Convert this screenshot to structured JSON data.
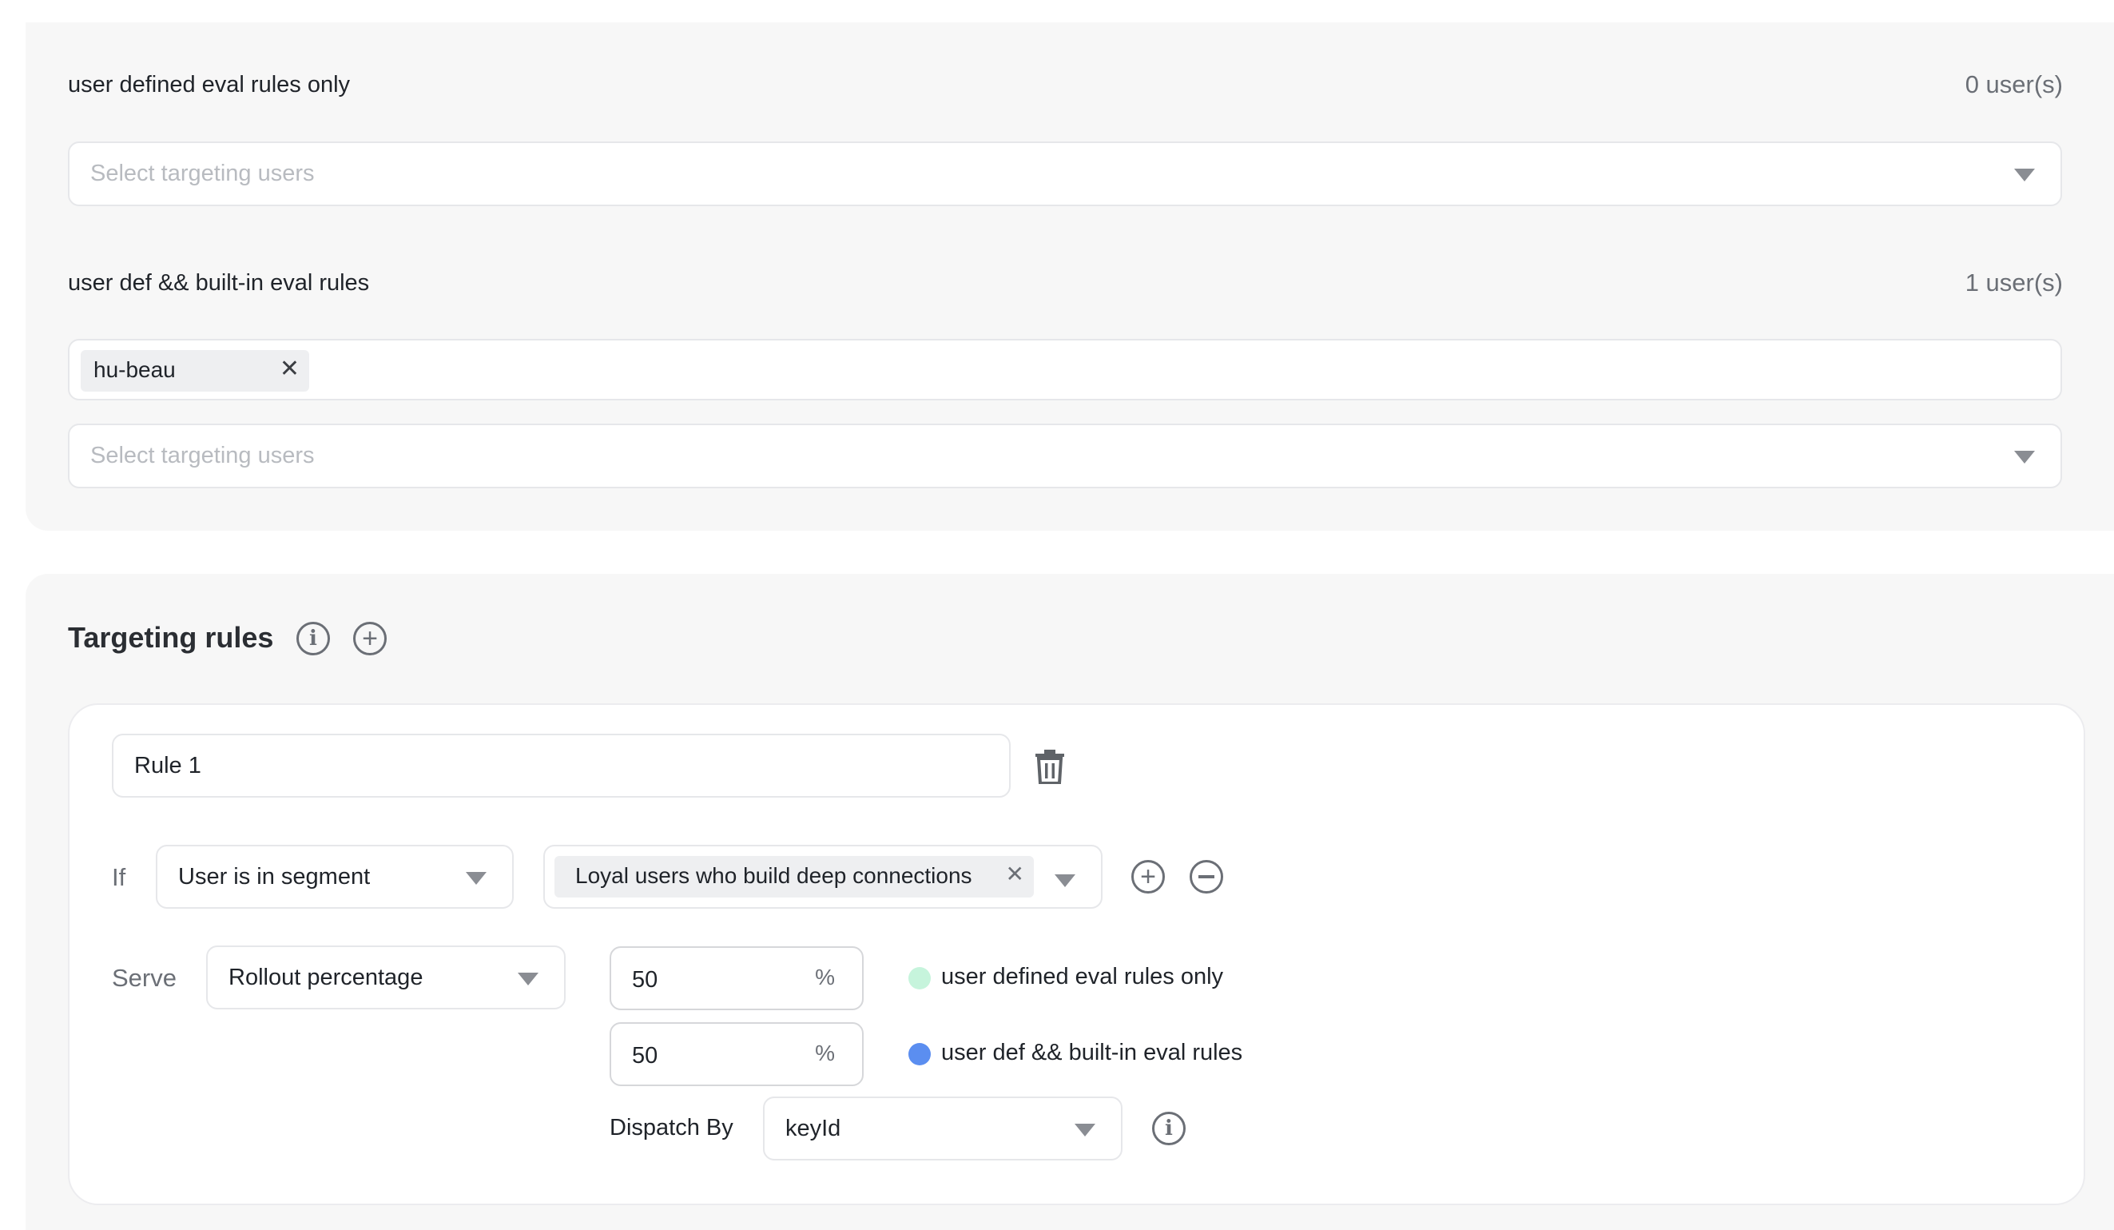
{
  "top_panel": {
    "group1": {
      "title": "user defined eval rules only",
      "count": "0 user(s)",
      "select_placeholder": "Select targeting users"
    },
    "group2": {
      "title": "user def && built-in eval rules",
      "count": "1 user(s)",
      "tags": [
        "hu-beau"
      ],
      "select_placeholder": "Select targeting users"
    }
  },
  "targeting": {
    "title": "Targeting rules",
    "rule": {
      "name_value": "Rule 1",
      "if_label": "If",
      "condition_value": "User is in segment",
      "segment_tag": "Loyal users who build deep connections",
      "serve_label": "Serve",
      "serve_value": "Rollout percentage",
      "rollouts": [
        {
          "percent": "50",
          "unit": "%",
          "variation": "user defined eval rules only",
          "color": "#c6f4dc"
        },
        {
          "percent": "50",
          "unit": "%",
          "variation": "user def && built-in eval rules",
          "color": "#5b8ef0"
        }
      ],
      "dispatch_label": "Dispatch By",
      "dispatch_value": "keyId"
    }
  }
}
